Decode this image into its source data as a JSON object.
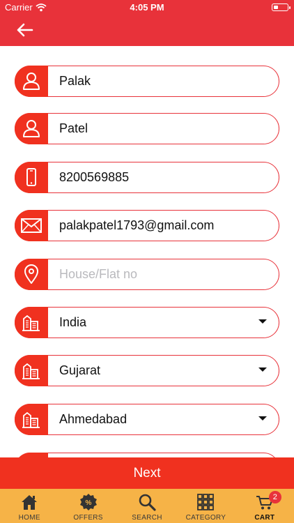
{
  "status_bar": {
    "carrier": "Carrier",
    "time": "4:05 PM"
  },
  "header": {
    "back_icon": "arrow-left-icon"
  },
  "form": {
    "fields": [
      {
        "name": "first-name",
        "icon": "user-icon",
        "value": "Palak"
      },
      {
        "name": "last-name",
        "icon": "user-icon",
        "value": "Patel"
      },
      {
        "name": "phone",
        "icon": "mobile-phone-icon",
        "value": "8200569885"
      },
      {
        "name": "email",
        "icon": "envelope-icon",
        "value": "palakpatel1793@gmail.com"
      },
      {
        "name": "house",
        "icon": "location-pin-icon",
        "value": "",
        "placeholder": "House/Flat no"
      },
      {
        "name": "country",
        "icon": "building-icon",
        "value": "India",
        "dropdown": true
      },
      {
        "name": "state",
        "icon": "building-icon",
        "value": "Gujarat",
        "dropdown": true
      },
      {
        "name": "city",
        "icon": "building-icon",
        "value": "Ahmedabad",
        "dropdown": true
      }
    ]
  },
  "next_button": {
    "label": "Next"
  },
  "tabbar": {
    "tabs": [
      {
        "label": "HOME",
        "icon": "home-icon"
      },
      {
        "label": "OFFERS",
        "icon": "discount-badge-icon"
      },
      {
        "label": "SEARCH",
        "icon": "search-icon"
      },
      {
        "label": "CATEGORY",
        "icon": "grid-icon"
      },
      {
        "label": "CART",
        "icon": "cart-icon",
        "badge": "2",
        "active": true
      }
    ]
  },
  "colors": {
    "primary": "#e8323a",
    "icon_bg": "#f0311f",
    "tabbar": "#f6b347",
    "placeholder": "#b9b9bd"
  }
}
